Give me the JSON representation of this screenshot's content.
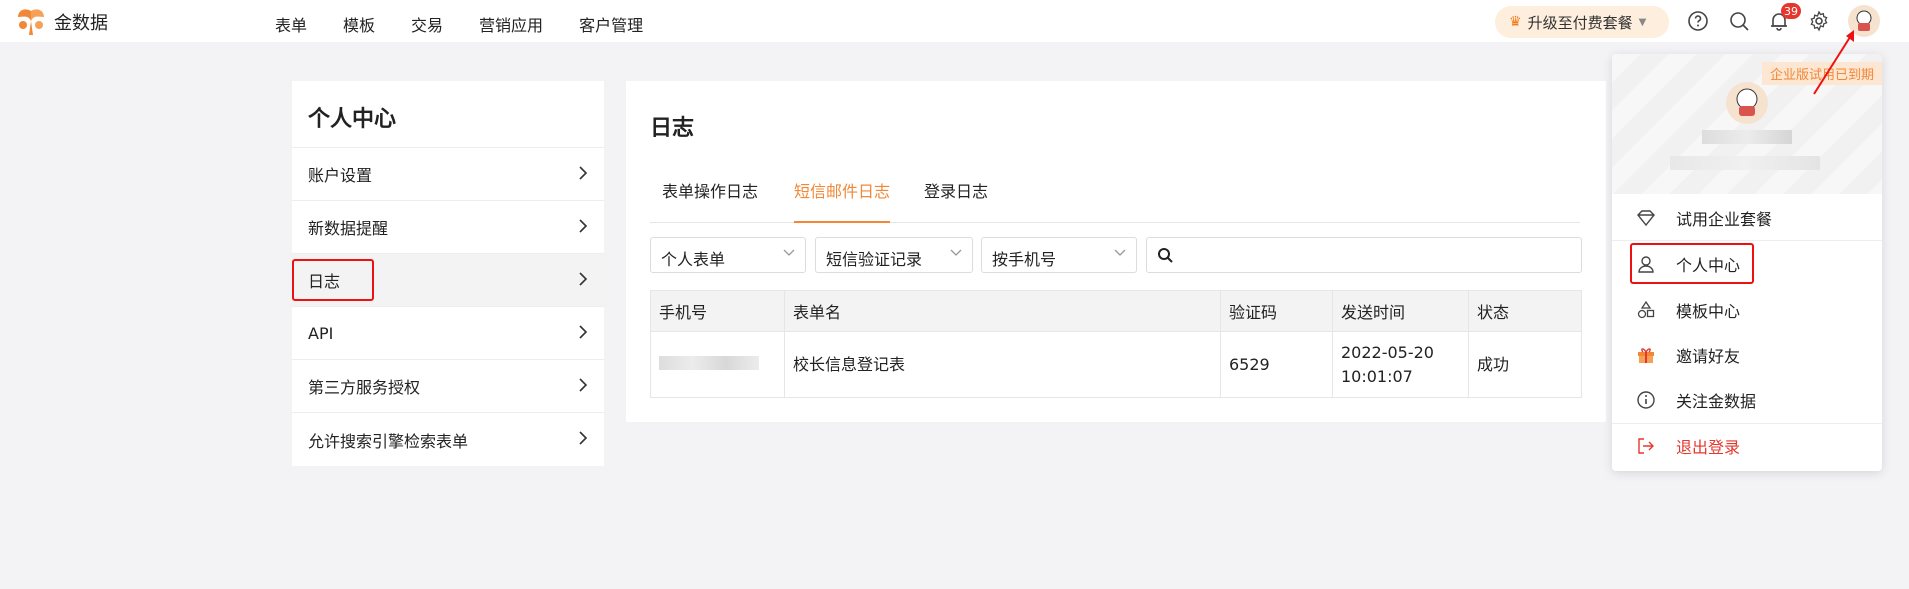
{
  "app": {
    "name": "金数据"
  },
  "topnav": [
    "表单",
    "模板",
    "交易",
    "营销应用",
    "客户管理"
  ],
  "upgrade_label": "升级至付费套餐",
  "notifications_count": "39",
  "sidebar": {
    "title": "个人中心",
    "items": [
      {
        "label": "账户设置"
      },
      {
        "label": "新数据提醒"
      },
      {
        "label": "日志"
      },
      {
        "label": "API"
      },
      {
        "label": "第三方服务授权"
      },
      {
        "label": "允许搜索引擎检索表单"
      }
    ]
  },
  "main": {
    "title": "日志",
    "tabs": [
      "表单操作日志",
      "短信邮件日志",
      "登录日志"
    ],
    "active_tab": "短信邮件日志",
    "filters": {
      "form_scope": "个人表单",
      "record_type": "短信验证记录",
      "search_by": "按手机号",
      "search_value": ""
    },
    "table": {
      "columns": [
        "手机号",
        "表单名",
        "验证码",
        "发送时间",
        "状态"
      ],
      "rows": [
        {
          "phone": "",
          "form_name": "校长信息登记表",
          "code": "6529",
          "send_date": "2022-05-20",
          "send_time": "10:01:07",
          "status": "成功"
        }
      ]
    }
  },
  "dropdown": {
    "trial_tag": "企业版试用已到期",
    "items": [
      {
        "label": "试用企业套餐",
        "icon": "diamond-icon"
      },
      {
        "label": "个人中心",
        "icon": "user-icon"
      },
      {
        "label": "模板中心",
        "icon": "shapes-icon"
      },
      {
        "label": "邀请好友",
        "icon": "gift-icon"
      },
      {
        "label": "关注金数据",
        "icon": "info-icon"
      },
      {
        "label": "退出登录",
        "icon": "logout-icon"
      }
    ]
  },
  "colors": {
    "accent": "#f08838",
    "danger": "#e5372d",
    "highlight": "#e11111"
  }
}
